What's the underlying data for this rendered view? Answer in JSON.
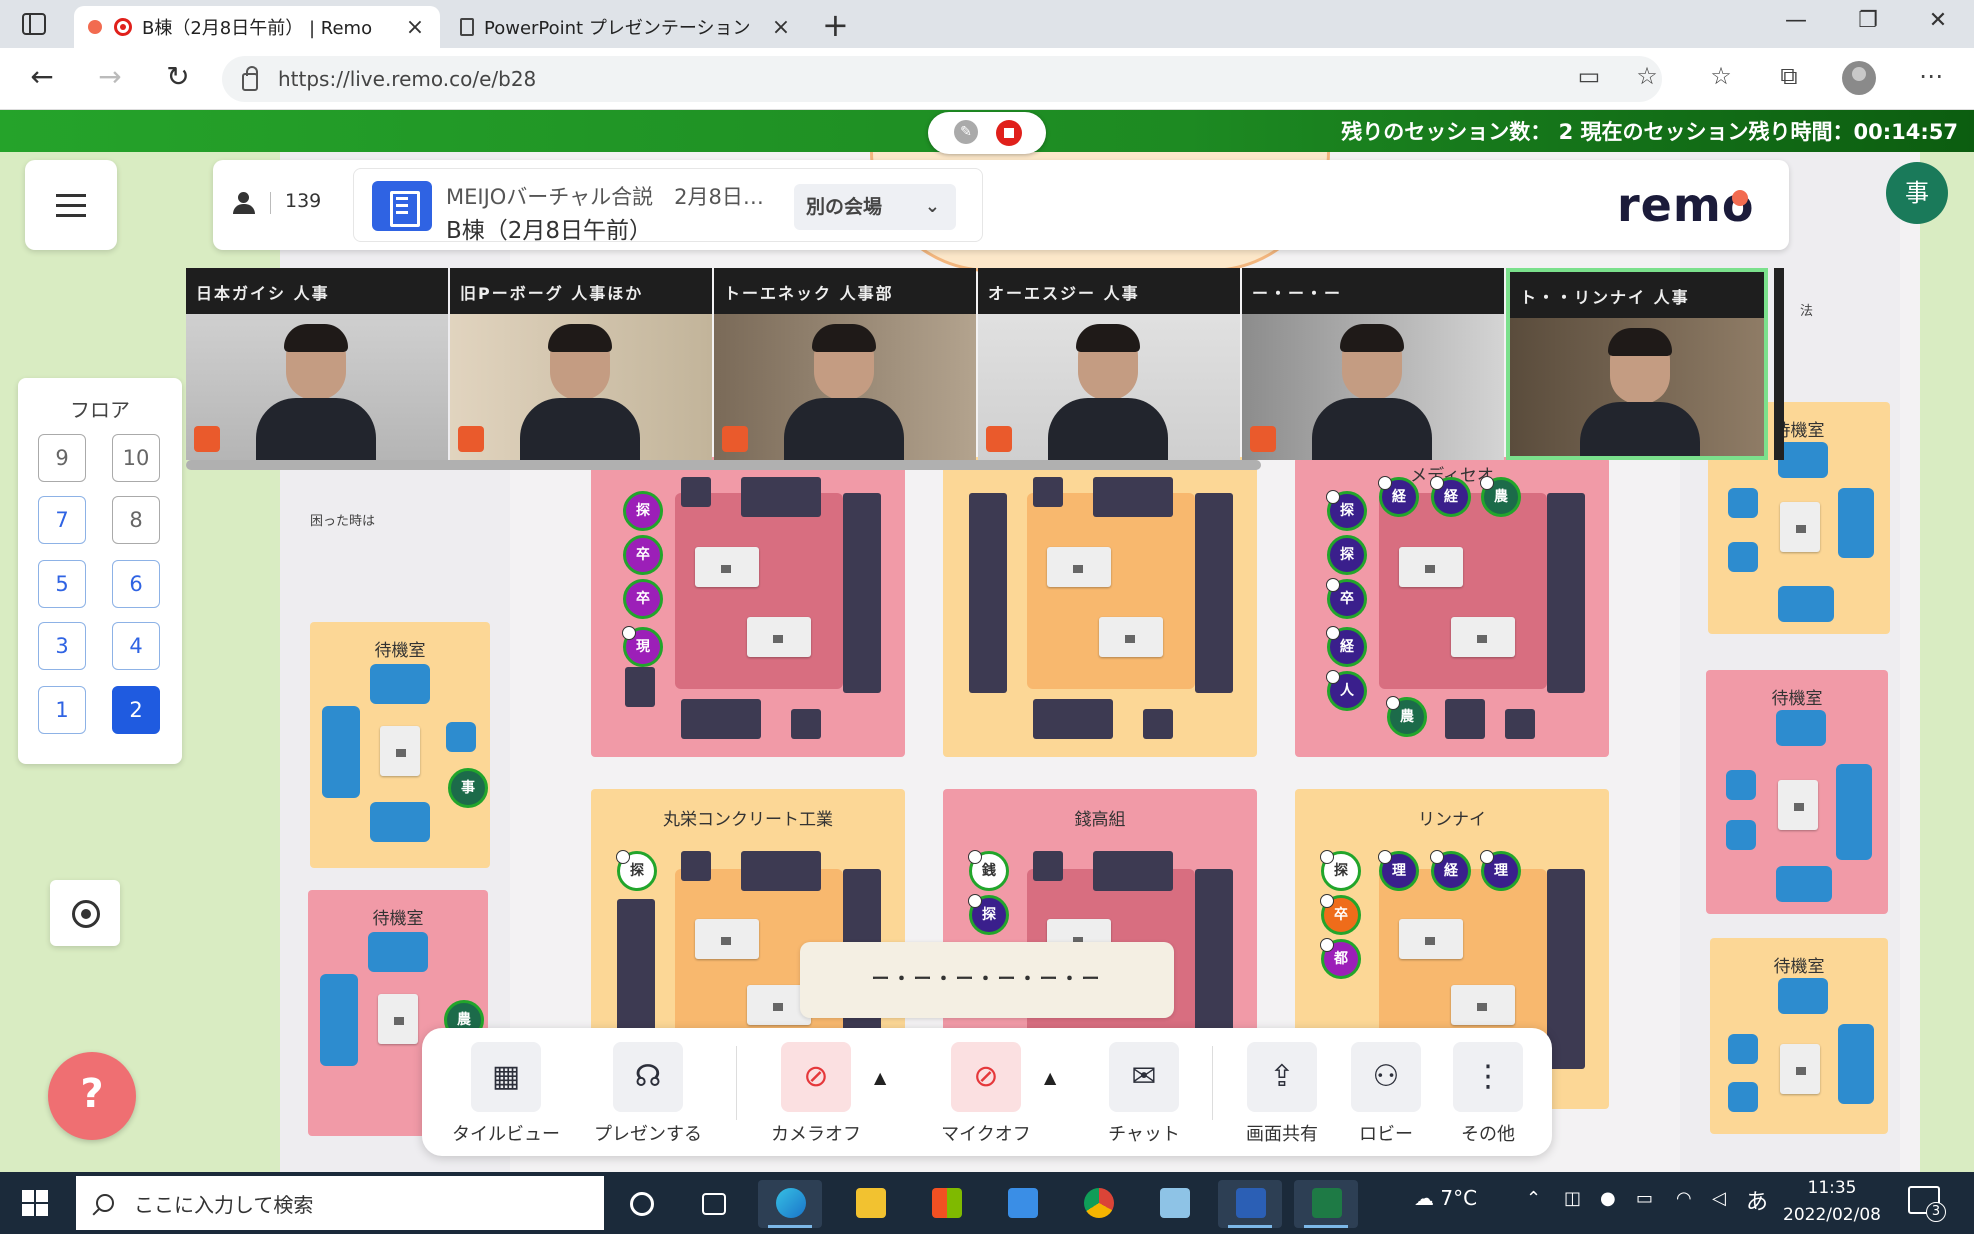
{
  "browser": {
    "tabs": [
      {
        "label": "B棟（2月8日午前） | Remo"
      },
      {
        "label": "PowerPoint プレゼンテーション"
      }
    ],
    "url": "https://live.remo.co/e/b28"
  },
  "session_bar": {
    "text": "残りのセッション数： 2 現在のセッション残り時間：00:14:57"
  },
  "header": {
    "attendee_count": "139",
    "event_title": "MEIJOバーチャル合説　2月8日…",
    "event_subtitle": "B棟（2月8日午前）",
    "venue_button": "別の会場",
    "logo": "remo",
    "me_avatar": "事"
  },
  "floor_panel": {
    "title": "フロア",
    "floors": [
      "9",
      "10",
      "7",
      "8",
      "5",
      "6",
      "3",
      "4",
      "1",
      "2"
    ],
    "active_floor": "2"
  },
  "troubled_link": "困った時は",
  "map": {
    "rooms": [
      {
        "name": "",
        "color": "pink"
      },
      {
        "name": "",
        "color": "yellow"
      },
      {
        "name": "メディセオ",
        "color": "pink"
      },
      {
        "name": "丸栄コンクリート工業",
        "color": "yellow"
      },
      {
        "name": "錢高組",
        "color": "pink"
      },
      {
        "name": "リンナイ",
        "color": "yellow"
      }
    ],
    "waiting_rooms": [
      "待機室",
      "待機室",
      "待機室",
      "待機室",
      "待機室"
    ],
    "avatars": {
      "room1": [
        "探",
        "卒",
        "卒",
        "現"
      ],
      "room3": [
        "探",
        "探",
        "卒",
        "経",
        "人",
        "経",
        "経",
        "農",
        "農"
      ],
      "room4": [
        "探"
      ],
      "room5": [
        "銭",
        "探"
      ],
      "room6": [
        "探",
        "卒",
        "都",
        "理",
        "経",
        "理"
      ],
      "wait1": [
        "事"
      ],
      "wait2": [
        "農"
      ]
    },
    "right_labels": [
      "法"
    ]
  },
  "video_tiles": [
    {
      "name": "日本ガイシ 人事"
    },
    {
      "name": "旧Pーボーグ 人事ほか"
    },
    {
      "name": "トーエネック 人事部"
    },
    {
      "name": "オーエスジー 人事"
    },
    {
      "name": "ー・ー・ー"
    },
    {
      "name": "ト・・リンナイ 人事"
    }
  ],
  "toast": "ー・ー・ー・ー・ー・ー",
  "controls": [
    {
      "label": "タイルビュー",
      "icon": "grid-icon"
    },
    {
      "label": "プレゼンする",
      "icon": "present-icon"
    },
    {
      "label": "カメラオフ",
      "icon": "camera-off-icon"
    },
    {
      "label": "マイクオフ",
      "icon": "mic-off-icon"
    },
    {
      "label": "チャット",
      "icon": "chat-icon"
    },
    {
      "label": "画面共有",
      "icon": "screen-share-icon"
    },
    {
      "label": "ロビー",
      "icon": "lobby-icon"
    },
    {
      "label": "その他",
      "icon": "more-icon"
    }
  ],
  "taskbar": {
    "search_placeholder": "ここに入力して検索",
    "weather": "7°C",
    "ime": "あ",
    "time": "11:35",
    "date": "2022/02/08",
    "notification_count": "3"
  },
  "colors": {
    "session_bar": "#1d8a22",
    "accent_blue": "#1f5be0",
    "room_pink": "#f19aa7",
    "room_yellow": "#fcd796",
    "avatar_purple": "#9c1fb8",
    "avatar_navy": "#3a1f8c",
    "help_button": "#ef6f72"
  }
}
